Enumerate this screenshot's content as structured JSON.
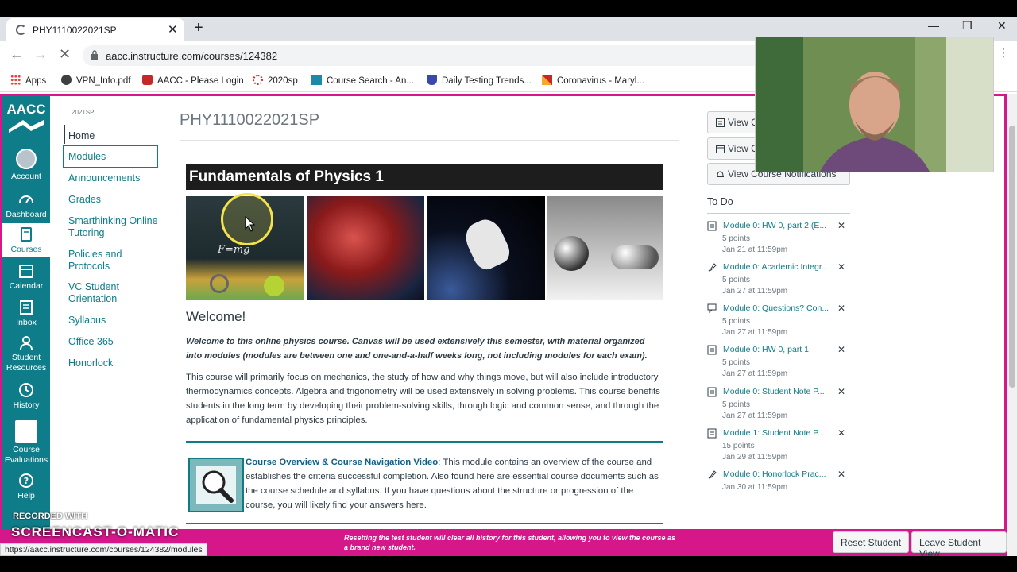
{
  "browser": {
    "tab_title": "PHY1110022021SP",
    "url": "aacc.instructure.com/courses/124382",
    "status_url": "https://aacc.instructure.com/courses/124382/modules",
    "bookmarks": [
      "Apps",
      "VPN_Info.pdf",
      "AACC - Please Login",
      "2020sp",
      "Course Search - An...",
      "Daily Testing Trends...",
      "Coronavirus - Maryl..."
    ]
  },
  "global_nav": {
    "logo": "AACC",
    "items": [
      "Account",
      "Dashboard",
      "Courses",
      "Calendar",
      "Inbox",
      "Student Resources",
      "History",
      "Course Evaluations",
      "Help"
    ]
  },
  "course_nav": {
    "term": "2021SP",
    "items": [
      "Home",
      "Modules",
      "Announcements",
      "Grades",
      "Smarthinking Online Tutoring",
      "Policies and Protocols",
      "VC Student Orientation",
      "Syllabus",
      "Office 365",
      "Honorlock"
    ]
  },
  "main": {
    "page_title": "PHY1110022021SP",
    "banner": "Fundamentals of Physics 1",
    "tiles": [
      "F=mg",
      "",
      "",
      ""
    ],
    "welcome": "Welcome!",
    "intro_bold": "Welcome to this online physics course. Canvas will be used extensively this semester, with material organized into modules (modules are between one and one-and-a-half weeks long, not including modules for each exam).",
    "intro": "This course will primarily focus on mechanics, the study of how and why things move, but will also include introductory thermodynamics concepts. Algebra and trigonometry will be used extensively in solving problems. This course benefits students in the long term by developing their problem-solving skills, through logic and common sense, and through the application of fundamental physics principles.",
    "overview_link": "Course Overview & Course Navigation Video",
    "overview_text": ": This module contains an overview of the course and establishes the criteria successful completion. Also found here are essential course documents such as the course schedule and syllabus. If you have questions about the structure or progression of the course, you will likely find your answers here."
  },
  "sidebar": {
    "buttons": [
      "View C",
      "View C",
      "View Course Notifications"
    ],
    "todo_title": "To Do",
    "todos": [
      {
        "title": "Module 0: HW 0, part 2 (E...",
        "points": "5 points",
        "due": "Jan 21 at 11:59pm"
      },
      {
        "title": "Module 0: Academic Integr...",
        "points": "5 points",
        "due": "Jan 27 at 11:59pm"
      },
      {
        "title": "Module 0: Questions? Con...",
        "points": "5 points",
        "due": "Jan 27 at 11:59pm"
      },
      {
        "title": "Module 0: HW 0, part 1",
        "points": "5 points",
        "due": "Jan 27 at 11:59pm"
      },
      {
        "title": "Module 0: Student Note P...",
        "points": "5 points",
        "due": "Jan 27 at 11:59pm"
      },
      {
        "title": "Module 1: Student Note P...",
        "points": "15 points",
        "due": "Jan 29 at 11:59pm"
      },
      {
        "title": "Module 0: Honorlock Prac...",
        "points": "5 points",
        "due": "Jan 30 at 11:59pm"
      }
    ]
  },
  "student_view": {
    "message": "Resetting the test student will clear all history for this student, allowing you to view the course as a brand new student.",
    "reset_button": "Reset Student",
    "leave_button": "Leave Student View"
  },
  "watermark": {
    "line1": "RECORDED WITH",
    "line2": "SCREENCAST-O-MATIC"
  },
  "colors": {
    "canvas_teal": "#0f7d89",
    "student_view_pink": "#d5178a",
    "banner_black": "#1d1d1d"
  }
}
